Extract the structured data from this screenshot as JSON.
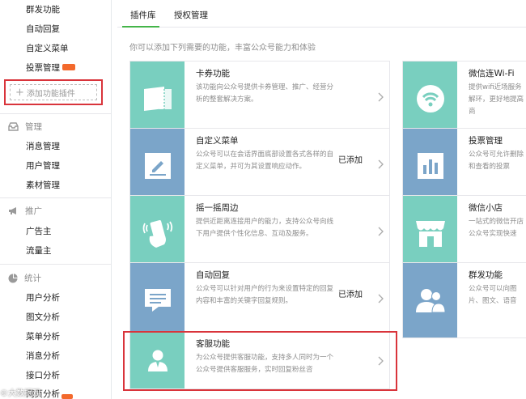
{
  "sidebar": {
    "top_items": [
      {
        "label": "群发功能"
      },
      {
        "label": "自动回复"
      },
      {
        "label": "自定义菜单"
      },
      {
        "label": "投票管理",
        "badge": "NEW"
      }
    ],
    "add_plugin": {
      "icon": "plus-icon",
      "label": "添加功能插件"
    },
    "sections": [
      {
        "title": "管理",
        "icon": "inbox-icon",
        "items": [
          "消息管理",
          "用户管理",
          "素材管理"
        ]
      },
      {
        "title": "推广",
        "icon": "megaphone-icon",
        "items": [
          "广告主",
          "流量主"
        ]
      },
      {
        "title": "统计",
        "icon": "pie-chart-icon",
        "items": [
          "用户分析",
          "图文分析",
          "菜单分析",
          "消息分析",
          "接口分析",
          "网页分析"
        ]
      }
    ]
  },
  "tabs": [
    {
      "label": "插件库",
      "active": true
    },
    {
      "label": "授权管理",
      "active": false
    }
  ],
  "intro": "你可以添加下列需要的功能，丰富公众号能力和体验",
  "cards": [
    {
      "title": "卡券功能",
      "desc": "该功能向公众号提供卡券管理、推广、经营分析的整套解决方案。",
      "status": "",
      "icon": "ticket-icon",
      "color": "#79cfbf"
    },
    {
      "title": "微信连Wi-Fi",
      "desc": "提供wifi近场服务解环，更好地提高商",
      "status": "",
      "icon": "wifi-icon",
      "color": "#79cfbf"
    },
    {
      "title": "自定义菜单",
      "desc": "公众号可以在会话界面底部设置各式各样的自定义菜单，并可为其设置响应动作。",
      "status": "已添加",
      "icon": "edit-icon",
      "color": "#7ba5c9"
    },
    {
      "title": "投票管理",
      "desc": "公众号可允许删除和查看的投票",
      "status": "",
      "icon": "bar-chart-icon",
      "color": "#7ba5c9"
    },
    {
      "title": "摇一摇周边",
      "desc": "提供近距离连接用户的能力，支持公众号向线下用户提供个性化信息、互动及服务。",
      "status": "",
      "icon": "shake-phone-icon",
      "color": "#79cfbf"
    },
    {
      "title": "微信小店",
      "desc": "一站式的微信开店公众号实现快速",
      "status": "",
      "icon": "store-icon",
      "color": "#79cfbf"
    },
    {
      "title": "自动回复",
      "desc": "公众号可以针对用户的行为来设置特定的回复内容和丰富的关键字回复规则。",
      "status": "已添加",
      "icon": "message-icon",
      "color": "#7ba5c9"
    },
    {
      "title": "群发功能",
      "desc": "公众号可以向图片、图文、语音",
      "status": "",
      "icon": "users-icon",
      "color": "#7ba5c9"
    },
    {
      "title": "客服功能",
      "desc": "为公众号提供客服功能，支持多人同时为一个公众号提供客服服务，实时回复粉丝咨",
      "status": "",
      "icon": "customer-service-icon",
      "color": "#79cfbf"
    }
  ],
  "watermark": "©大数据观"
}
